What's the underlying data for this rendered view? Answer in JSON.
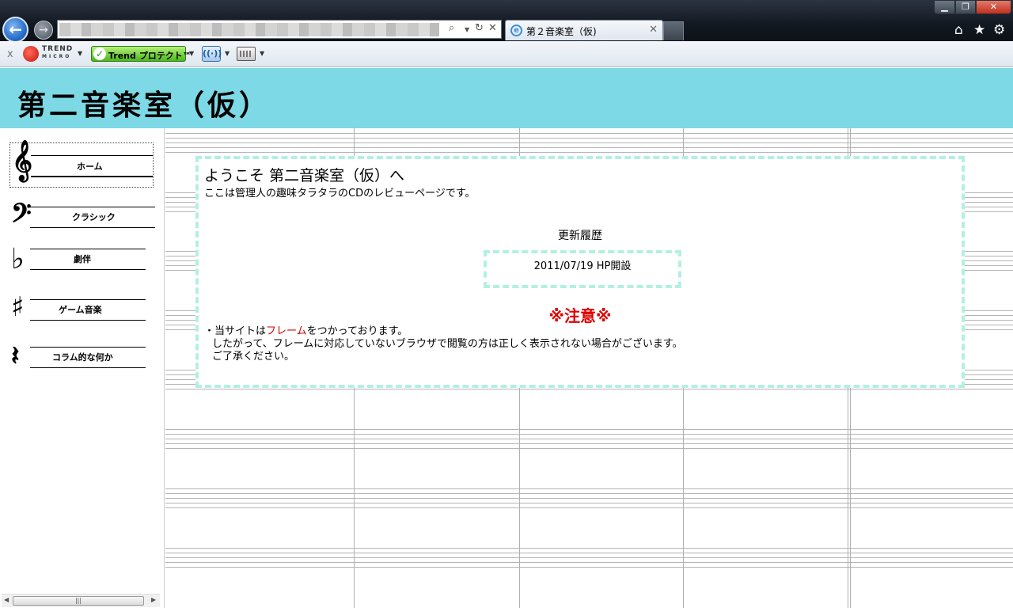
{
  "browser": {
    "tab_title": "第２音楽室（仮)",
    "toolbar": {
      "close_glyph": "x",
      "trend_logo_text_line1": "TREND",
      "trend_logo_text_line2": "MICRO",
      "trend_protect_label": "Trend プロテクト™"
    }
  },
  "site": {
    "title": "第二音楽室（仮）"
  },
  "nav": {
    "items": [
      {
        "label": "ホーム",
        "icon": "treble-clef-icon"
      },
      {
        "label": "クラシック",
        "icon": "bass-clef-icon"
      },
      {
        "label": "劇伴",
        "icon": "flat-sign-icon"
      },
      {
        "label": "ゲーム音楽",
        "icon": "sharp-sign-icon"
      },
      {
        "label": "コラム的な何か",
        "icon": "quarter-rest-icon"
      }
    ]
  },
  "main": {
    "welcome_title": "ようこそ  第二音楽室（仮）へ",
    "welcome_subtitle": "ここは管理人の趣味タラタラのCDのレビューページです。",
    "history_heading": "更新履歴",
    "history_entries": [
      "2011/07/19   HP開設"
    ],
    "notice_heading": "※注意※",
    "notice": {
      "line1_prefix": "・当サイトは",
      "line1_link": "フレーム",
      "line1_suffix": "をつかっております。",
      "line2": "したがって、フレームに対応していないブラウザで閲覧の方は正しく表示されない場合がございます。",
      "line3": "ご了承ください。"
    }
  },
  "colors": {
    "header_bg": "#7dd9e6",
    "dashed_border": "#b2f0e0",
    "notice_red": "#e00000"
  }
}
